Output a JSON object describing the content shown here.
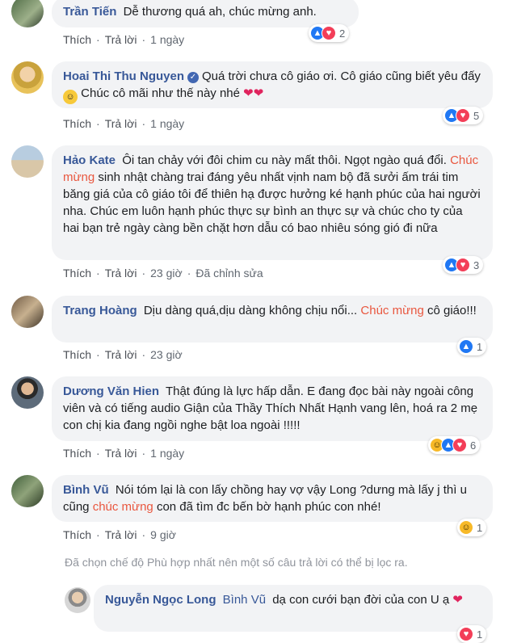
{
  "colors": {
    "name": "#385898",
    "highlight": "#e9573f",
    "bubble": "#f2f3f5",
    "like": "#2078f4",
    "love": "#f33e58"
  },
  "labels": {
    "like": "Thích",
    "reply": "Trả lời",
    "edited": "Đã chỉnh sửa"
  },
  "comments": [
    {
      "name": "Trần Tiến",
      "text": "Dễ thương quá ah, chúc mừng anh.",
      "time": "1 ngày",
      "reactions": [
        "like",
        "love"
      ],
      "count": "2"
    },
    {
      "name": "Hoai Thi Thu Nguyen",
      "verified": true,
      "text": "Quá trời chưa cô giáo ơi. Cô giáo cũng biết yêu đấy",
      "text_after": "Chúc cô mãi như thế này nhé",
      "time": "1 ngày",
      "reactions": [
        "like",
        "love"
      ],
      "count": "5"
    },
    {
      "name": "Hảo Kate",
      "text_before": "Ôi tan chảy với đôi chim cu này mất thôi. Ngọt ngào quá đổi.",
      "highlight": "Chúc mừng",
      "text_after": "sinh nhật chàng trai đáng yêu nhất vịnh nam bộ đã sưởi ấm trái tim băng giá của cô giáo tôi để thiên hạ được hưởng ké hạnh phúc của hai người nha. Chúc em luôn hạnh phúc thực sự bình an thực sự và chúc cho ty của hai bạn trẻ ngày càng bền chặt hơn dẫu có bao nhiêu sóng gió đi nữa",
      "time": "23 giờ",
      "edited": true,
      "reactions": [
        "like",
        "love"
      ],
      "count": "3"
    },
    {
      "name": "Trang Hoàng",
      "text_before": "Dịu dàng quá,dịu dàng không chịu nổi...",
      "highlight": "Chúc mừng",
      "text_after": "cô giáo!!!",
      "time": "23 giờ",
      "reactions": [
        "like"
      ],
      "count": "1"
    },
    {
      "name": "Dương Văn Hien",
      "text": "Thật đúng là lực hấp dẫn. E đang đọc bài này ngoài công viên và có tiếng audio Giận của Thầy Thích Nhất Hạnh vang lên, hoá ra 2 mẹ con chị kia đang ngồi nghe bật loa ngoài !!!!!",
      "time": "1 ngày",
      "reactions": [
        "haha",
        "like",
        "love"
      ],
      "count": "6"
    },
    {
      "name": "Bình Vũ",
      "text_before": "Nói tóm lại là con lấy chồng hay vợ vậy Long ?dưng mà lấy j thì u cũng",
      "highlight": "chúc mừng",
      "text_after": "con đã tìm đc bến bờ hạnh phúc con nhé!",
      "time": "9 giờ",
      "reactions": [
        "haha"
      ],
      "count": "1"
    }
  ],
  "notice": "Đã chọn chế độ Phù hợp nhất nên một số câu trả lời có thể bị lọc ra.",
  "reply": {
    "name": "Nguyễn Ngọc Long",
    "mention": "Bình Vũ",
    "text": "dạ con cưới bạn đời của con U ạ",
    "reactions": [
      "love"
    ],
    "count": "1"
  }
}
